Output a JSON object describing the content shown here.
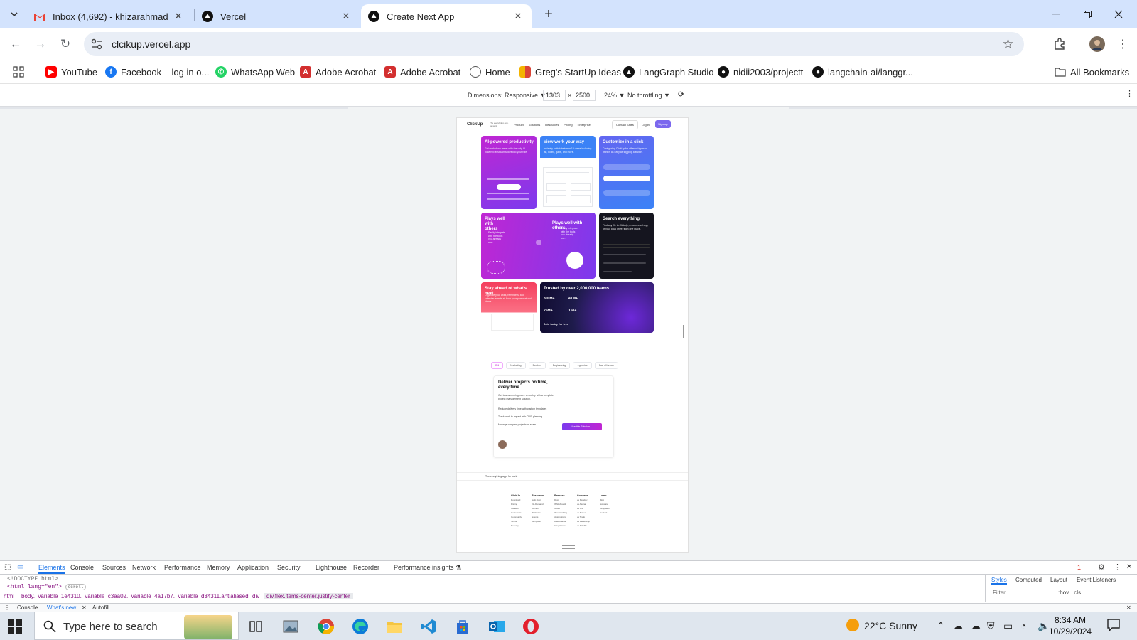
{
  "browser": {
    "tabs": [
      {
        "title": "Inbox (4,692) - khizarahmad333",
        "icon": "gmail-icon"
      },
      {
        "title": "Vercel",
        "icon": "vercel-icon"
      },
      {
        "title": "Create Next App",
        "icon": "vercel-icon",
        "active": true
      }
    ],
    "url": "clcikup.vercel.app",
    "bookmarks": [
      {
        "label": "YouTube",
        "icon": "youtube-icon",
        "color": "#ff0000"
      },
      {
        "label": "Facebook – log in o...",
        "icon": "facebook-icon",
        "color": "#1877f2"
      },
      {
        "label": "WhatsApp Web",
        "icon": "whatsapp-icon",
        "color": "#25d366"
      },
      {
        "label": "Adobe Acrobat",
        "icon": "acrobat-icon",
        "color": "#d32f2f"
      },
      {
        "label": "Adobe Acrobat",
        "icon": "acrobat-icon",
        "color": "#d32f2f"
      },
      {
        "label": "Home",
        "icon": "globe-icon",
        "color": "#5f6368"
      },
      {
        "label": "Greg's StartUp Ideas",
        "icon": "grid-icon",
        "color": "#f4b400"
      },
      {
        "label": "LangGraph Studio",
        "icon": "langgraph-icon",
        "color": "#111111"
      },
      {
        "label": "nidii2003/projectt",
        "icon": "github-icon",
        "color": "#111111"
      },
      {
        "label": "langchain-ai/langgr...",
        "icon": "github-icon",
        "color": "#111111"
      }
    ],
    "all_bookmarks": "All Bookmarks"
  },
  "device_toolbar": {
    "dimensions": "Dimensions: Responsive ▼",
    "width": "1303",
    "times": "×",
    "height": "2500",
    "zoom": "24% ▼",
    "throttling": "No throttling ▼"
  },
  "page": {
    "nav": {
      "logo": "ClickUp",
      "tagline": "The everything app, for work",
      "links": [
        "Product",
        "Solutions",
        "Resources",
        "Pricing",
        "Enterprise"
      ],
      "contact": "Contact Sales",
      "login": "Log in",
      "signup": "Sign up"
    },
    "cards": [
      {
        "title": "AI-powered productivity",
        "text": "Get work done faster with the only AI-powered assistant tailored to your role."
      },
      {
        "title": "View work your way",
        "text": "Instantly switch between 15 views including list, board, gantt, and more."
      },
      {
        "title": "Customize in a click",
        "text": "Configuring ClickUp for different types of work is as easy as toggling a switch."
      },
      {
        "title": "Plays well with others",
        "text": "Easily integrate with the tools you already use."
      },
      {
        "title": "Plays well with others",
        "text": "Easily integrate with the tools you already use."
      },
      {
        "title": "Search everything",
        "text": "Find any file in ClickUp, a connected app, or your local drive, from one place."
      },
      {
        "title": "Stay ahead of what's next",
        "text": "Organize your work, reminders, and calendar events all from your personalized Home."
      },
      {
        "title": "Trusted by over 2,000,000 teams",
        "text": "Join today for free"
      }
    ],
    "stats": [
      "300M+",
      "4TM+",
      "25M+",
      "150+"
    ],
    "solution_tabs": [
      "PM",
      "Marketing",
      "Product",
      "Engineering",
      "Agencies",
      "See all teams"
    ],
    "deliver": {
      "title": "Deliver projects on time, every time",
      "text": "Get teams running more smoothly with a complete project management solution.",
      "bullets": [
        "Reduce delivery time with custom templates",
        "Track work to impact with OKR planning",
        "Manage complex projects at scale"
      ],
      "cta": "Use this Solution →"
    },
    "footer_tagline": "The everything app, for work.",
    "footer_columns": [
      {
        "head": "ClickUp",
        "items": [
          "Download",
          "Pricing",
          "Careers",
          "Customers",
          "Community",
          "Terms",
          "Security"
        ]
      },
      {
        "head": "Resources",
        "items": [
          "Help Docs",
          "On-Demand",
          "Demos",
          "Webinars",
          "Events",
          "Templates"
        ]
      },
      {
        "head": "Features",
        "items": [
          "Docs",
          "Whiteboards",
          "Goals",
          "Time tracking",
          "Automations",
          "Dashboards",
          "Integrations"
        ]
      },
      {
        "head": "Compare",
        "items": [
          "vs Monday",
          "vs Asana",
          "vs Jira",
          "vs Notion",
          "vs Trello",
          "vs Basecamp",
          "vs Airtable"
        ]
      },
      {
        "head": "Learn",
        "items": [
          "Blog",
          "Software",
          "Templates",
          "Contact"
        ]
      }
    ]
  },
  "devtools": {
    "tabs": [
      "Elements",
      "Console",
      "Sources",
      "Network",
      "Performance",
      "Memory",
      "Application",
      "Security",
      "Lighthouse",
      "Recorder",
      "Performance insights ⚗"
    ],
    "html_line1": "<!DOCTYPE html>",
    "html_line2": "<html lang=\"en\">",
    "scroll_badge": "scroll",
    "breadcrumbs": [
      "html",
      "body._variable_1e4310._variable_c3aa02._variable_4a17b7._variable_d34311.antialiased",
      "div",
      "div.flex.items-center.justify-center"
    ],
    "styles_tabs": [
      "Styles",
      "Computed",
      "Layout",
      "Event Listeners"
    ],
    "filter_placeholder": "Filter",
    "hov": ":hov",
    "cls": ".cls",
    "drawer_tabs": [
      "Console",
      "What's new",
      "Autofill"
    ],
    "error_count": "1"
  },
  "taskbar": {
    "search_placeholder": "Type here to search",
    "weather": "22°C  Sunny",
    "time": "8:34 AM",
    "date": "10/29/2024"
  }
}
